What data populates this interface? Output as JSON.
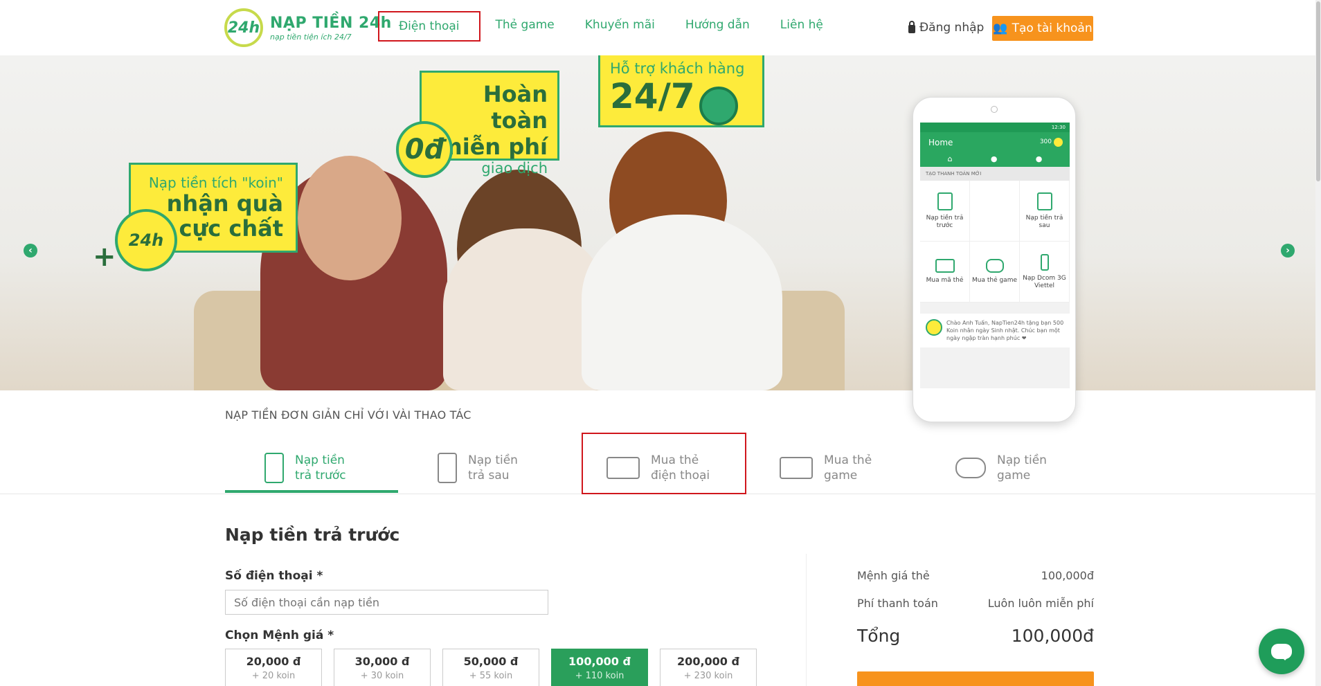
{
  "header": {
    "logo_mark": "24h",
    "logo_title": "NẠP TIỀN 24h",
    "logo_subtitle": "nạp tiền tiện ích 24/7",
    "nav": [
      "Điện thoại",
      "Thẻ game",
      "Khuyến mãi",
      "Hướng dẫn",
      "Liên hệ"
    ],
    "login": "Đăng nhập",
    "signup": "Tạo tài khoản"
  },
  "banner": {
    "bubble1_small": "Nạp tiền tích \"koin\"",
    "bubble1_line1": "nhận quà",
    "bubble1_line2": "cực chất",
    "koin_badge": "24h",
    "bubble2_line1": "Hoàn toàn",
    "bubble2_line2": "miễn phí",
    "bubble2_small": "giao dịch",
    "zero_badge": "0đ",
    "bubble3_small": "Hỗ trợ khách hàng",
    "bubble3_big": "24/7",
    "phone": {
      "status_time": "12:30",
      "title": "Home",
      "koin": "300",
      "section": "TẠO THANH TOÁN MỚI",
      "tiles": [
        "Nạp tiền trả trước",
        "Nạp tiền trả sau",
        "Mua mã thẻ",
        "Mua thẻ game",
        "Nạp Dcom 3G Viettel"
      ],
      "message": "Chào Anh Tuấn, NapTien24h tặng bạn 500 Koin nhân ngày Sinh nhật. Chúc bạn một ngày ngập tràn hạnh phúc ❤"
    }
  },
  "steps": {
    "title": "NẠP TIỀN ĐƠN GIẢN CHỈ VỚI VÀI THAO TÁC",
    "items": [
      {
        "line1": "Nạp tiền",
        "line2": "trả trước"
      },
      {
        "line1": "Nạp tiền",
        "line2": "trả sau"
      },
      {
        "line1": "Mua thẻ",
        "line2": "điện thoại"
      },
      {
        "line1": "Mua thẻ",
        "line2": "game"
      },
      {
        "line1": "Nạp tiền",
        "line2": "game"
      }
    ]
  },
  "form": {
    "title": "Nạp tiền trả trước",
    "phone_label": "Số điện thoại *",
    "phone_placeholder": "Số điện thoại cần nạp tiền",
    "amount_label": "Chọn Mệnh giá *",
    "amounts": [
      {
        "value": "20,000 đ",
        "koin": "+ 20 koin"
      },
      {
        "value": "30,000 đ",
        "koin": "+ 30 koin"
      },
      {
        "value": "50,000 đ",
        "koin": "+ 55 koin"
      },
      {
        "value": "100,000 đ",
        "koin": "+ 110 koin"
      },
      {
        "value": "200,000 đ",
        "koin": "+ 230 koin"
      }
    ],
    "selected_index": 3
  },
  "summary": {
    "face_label": "Mệnh giá thẻ",
    "face_value": "100,000đ",
    "fee_label": "Phí thanh toán",
    "fee_value": "Luôn luôn miễn phí",
    "total_label": "Tổng",
    "total_value": "100,000đ"
  },
  "colors": {
    "brand_green": "#2fa86e",
    "accent_orange": "#f7931d",
    "highlight_red": "#d0161c",
    "banner_yellow": "#fdeb3b"
  }
}
